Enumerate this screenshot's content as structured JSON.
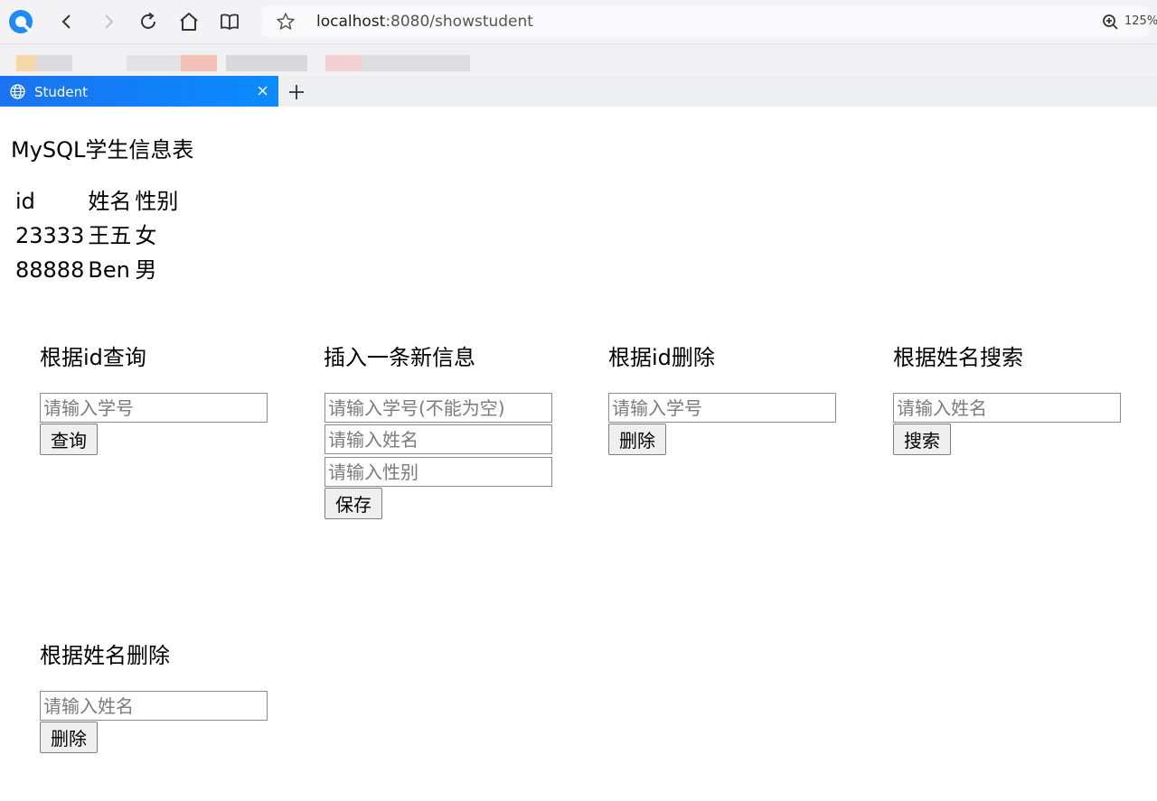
{
  "browser": {
    "url_host": "localhost",
    "url_path": ":8080/showstudent",
    "zoom": "125%",
    "tab_title": "Student"
  },
  "page": {
    "title": "MySQL学生信息表",
    "table": {
      "headers": [
        "id",
        "姓名",
        "性别"
      ],
      "rows": [
        [
          "23333",
          "王五",
          "女"
        ],
        [
          "88888",
          "Ben",
          "男"
        ]
      ]
    },
    "query_by_id": {
      "title": "根据id查询",
      "placeholder": "请输入学号",
      "button": "查询"
    },
    "insert": {
      "title": "插入一条新信息",
      "placeholder_id": "请输入学号(不能为空)",
      "placeholder_name": "请输入姓名",
      "placeholder_gender": "请输入性别",
      "button": "保存"
    },
    "delete_by_id": {
      "title": "根据id删除",
      "placeholder": "请输入学号",
      "button": "删除"
    },
    "search_by_name": {
      "title": "根据姓名搜索",
      "placeholder": "请输入姓名",
      "button": "搜索"
    },
    "delete_by_name": {
      "title": "根据姓名删除",
      "placeholder": "请输入姓名",
      "button": "删除"
    }
  }
}
